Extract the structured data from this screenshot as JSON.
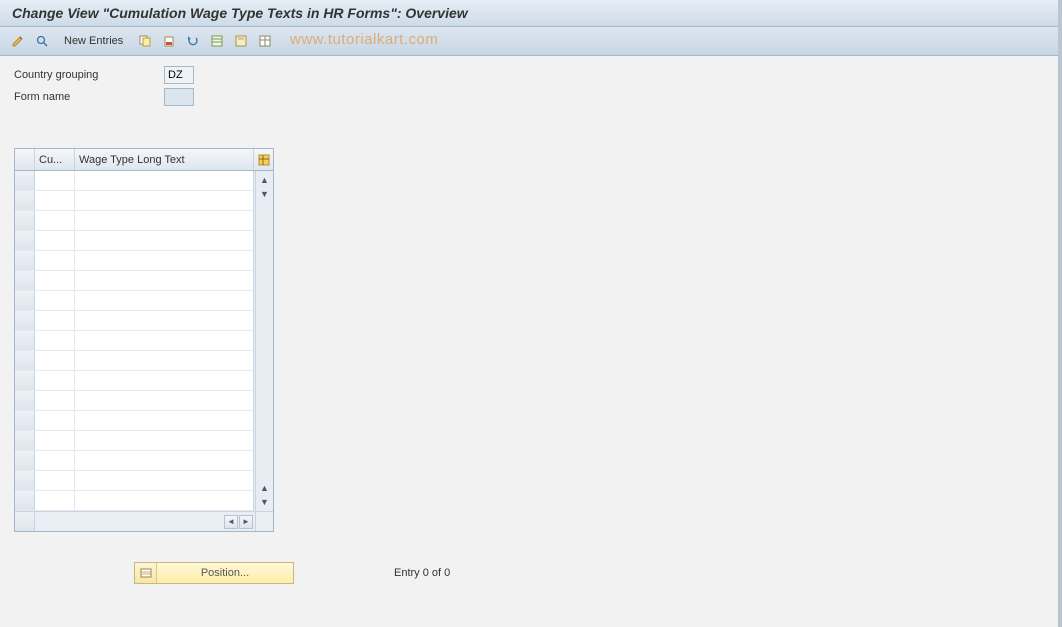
{
  "title": "Change View \"Cumulation Wage Type Texts in HR Forms\": Overview",
  "toolbar": {
    "new_entries_label": "New Entries"
  },
  "watermark": "www.tutorialkart.com",
  "fields": {
    "country_grouping_label": "Country grouping",
    "country_grouping_value": "DZ",
    "form_name_label": "Form name",
    "form_name_value": ""
  },
  "grid": {
    "col1_header": "Cu...",
    "col2_header": "Wage Type Long Text",
    "row_count": 17
  },
  "footer": {
    "position_label": "Position...",
    "entry_text": "Entry 0 of 0"
  }
}
